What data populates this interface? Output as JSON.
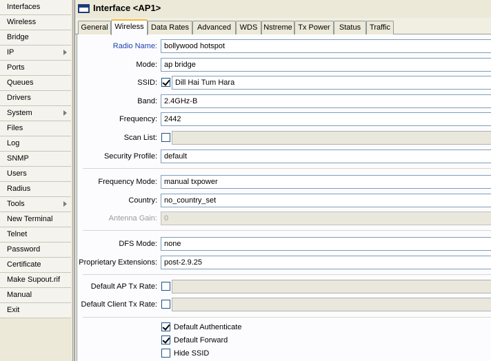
{
  "sidebar": {
    "items": [
      {
        "label": "Interfaces",
        "arrow": false
      },
      {
        "label": "Wireless",
        "arrow": false
      },
      {
        "label": "Bridge",
        "arrow": false
      },
      {
        "label": "IP",
        "arrow": true
      },
      {
        "label": "Ports",
        "arrow": false
      },
      {
        "label": "Queues",
        "arrow": false
      },
      {
        "label": "Drivers",
        "arrow": false
      },
      {
        "label": "System",
        "arrow": true
      },
      {
        "label": "Files",
        "arrow": false
      },
      {
        "label": "Log",
        "arrow": false
      },
      {
        "label": "SNMP",
        "arrow": false
      },
      {
        "label": "Users",
        "arrow": false
      },
      {
        "label": "Radius",
        "arrow": false
      },
      {
        "label": "Tools",
        "arrow": true
      },
      {
        "label": "New Terminal",
        "arrow": false
      },
      {
        "label": "Telnet",
        "arrow": false
      },
      {
        "label": "Password",
        "arrow": false
      },
      {
        "label": "Certificate",
        "arrow": false
      },
      {
        "label": "Make Supout.rif",
        "arrow": false
      },
      {
        "label": "Manual",
        "arrow": false
      },
      {
        "label": "Exit",
        "arrow": false
      }
    ]
  },
  "window": {
    "title": "Interface <AP1>",
    "tabs": [
      "General",
      "Wireless",
      "Data Rates",
      "Advanced",
      "WDS",
      "Nstreme",
      "Tx Power",
      "Status",
      "Traffic"
    ],
    "active_tab": "Wireless"
  },
  "form": {
    "radio_name": {
      "label": "Radio Name:",
      "value": "bollywood hotspot"
    },
    "mode": {
      "label": "Mode:",
      "value": "ap bridge"
    },
    "ssid": {
      "label": "SSID:",
      "value": "Dill Hai Tum Hara",
      "checked": true
    },
    "band": {
      "label": "Band:",
      "value": "2.4GHz-B"
    },
    "frequency": {
      "label": "Frequency:",
      "value": "2442"
    },
    "scan_list": {
      "label": "Scan List:",
      "value": "",
      "checked": false
    },
    "security_profile": {
      "label": "Security Profile:",
      "value": "default"
    },
    "frequency_mode": {
      "label": "Frequency Mode:",
      "value": "manual txpower"
    },
    "country": {
      "label": "Country:",
      "value": "no_country_set"
    },
    "antenna_gain": {
      "label": "Antenna Gain:",
      "value": "0"
    },
    "dfs_mode": {
      "label": "DFS Mode:",
      "value": "none"
    },
    "proprietary_extensions": {
      "label": "Proprietary Extensions:",
      "value": "post-2.9.25"
    },
    "default_ap_tx_rate": {
      "label": "Default AP Tx Rate:",
      "value": "",
      "checked": false
    },
    "default_client_tx_rate": {
      "label": "Default Client Tx Rate:",
      "value": "",
      "checked": false
    },
    "default_authenticate": {
      "label": "Default Authenticate",
      "checked": true
    },
    "default_forward": {
      "label": "Default Forward",
      "checked": true
    },
    "hide_ssid": {
      "label": "Hide SSID",
      "checked": false
    }
  },
  "colors": {
    "accent_label": "#1b3fae",
    "active_tab_border": "#f5b738"
  }
}
